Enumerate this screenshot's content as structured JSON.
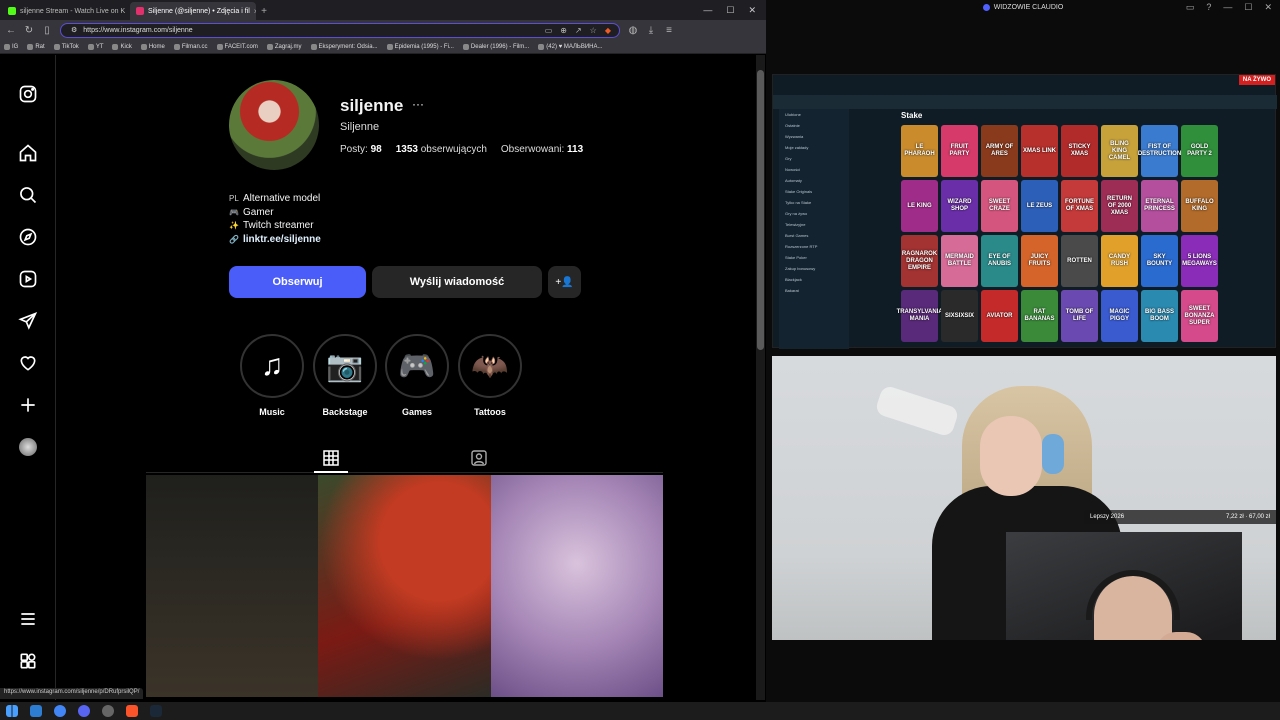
{
  "browser": {
    "tabs": [
      {
        "label": "siljenne Stream - Watch Live on K",
        "color": "#53fc18"
      },
      {
        "label": "Siljenne (@siljenne) • Zdjęcia i fil",
        "color": "#e1306c"
      }
    ],
    "url": "https://www.instagram.com/siljenne",
    "bookmarks": [
      "IG",
      "Rat",
      "TikTok",
      "YT",
      "Kick",
      "Home",
      "Filman.cc",
      "FACEIT.com",
      "Zagraj.my",
      "Eksperyment: Odsia...",
      "Epidemia (1995) - Fi...",
      "Dealer (1996) - Film...",
      "(42) ♥ МАЛЬВИНА..."
    ],
    "status_url": "https://www.instagram.com/siljenne/p/DRufprsilQP/"
  },
  "profile": {
    "username": "siljenne",
    "more": "···",
    "full_name": "Siljenne",
    "posts_label": "Posty:",
    "posts_count": "98",
    "followers": "1353",
    "followers_label": "obserwujących",
    "following_label": "Obserwowani:",
    "following_count": "113",
    "bio": [
      {
        "icon": "PL",
        "text": "Alternative model"
      },
      {
        "icon": "🎮",
        "text": "Gamer"
      },
      {
        "icon": "✨",
        "text": "Twitch streamer"
      }
    ],
    "link": "linktr.ee/siljenne",
    "follow_label": "Obserwuj",
    "message_label": "Wyślij wiadomość",
    "suggest_label": "+ꞌ",
    "highlights": [
      {
        "label": "Music",
        "glyph": "♫"
      },
      {
        "label": "Backstage",
        "glyph": "📷"
      },
      {
        "label": "Games",
        "glyph": "🎮"
      },
      {
        "label": "Tattoos",
        "glyph": "🦇"
      }
    ]
  },
  "obs": {
    "title": "WIDZOWIE CLAUDIO",
    "live_badge": "NA ŻYWO",
    "donation_name": "Lepszy 2026",
    "donation_amount": "7,22 zł · 67,00 zł"
  },
  "stake": {
    "logo": "Stake",
    "sidebar": [
      "Ulubione",
      "Ostatnie",
      "Wyzwania",
      "Moje zakłady",
      "Gry",
      "Nowości",
      "Automaty",
      "Stake Originals",
      "Tylko na Stake",
      "Gry na żywo",
      "Telewizyjne",
      "Burst Games",
      "Rozszerzone RTP",
      "Stake Poker",
      "Zakup bonusowy",
      "Blackjack",
      "Bakarat"
    ],
    "games": [
      {
        "name": "LE PHARAOH",
        "color": "#c98b2c"
      },
      {
        "name": "FRUIT PARTY",
        "color": "#d63a6a"
      },
      {
        "name": "ARMY OF ARES",
        "color": "#8a3a1c"
      },
      {
        "name": "XMAS LINK",
        "color": "#b8302c"
      },
      {
        "name": "STICKY XMAS",
        "color": "#b22b2b"
      },
      {
        "name": "BLING KING CAMEL",
        "color": "#c7a23b"
      },
      {
        "name": "FIST OF DESTRUCTION",
        "color": "#3a7bd0"
      },
      {
        "name": "GOLD PARTY 2",
        "color": "#2f8f3b"
      },
      {
        "name": "LE KING",
        "color": "#a02c8a"
      },
      {
        "name": "WIZARD SHOP",
        "color": "#6a2fa8"
      },
      {
        "name": "SWEET CRAZE",
        "color": "#d4567e"
      },
      {
        "name": "LE ZEUS",
        "color": "#2c5fb8"
      },
      {
        "name": "FORTUNE OF XMAS",
        "color": "#c43a3a"
      },
      {
        "name": "RETURN OF 2000 XMAS",
        "color": "#9e2d56"
      },
      {
        "name": "ETERNAL PRINCESS",
        "color": "#b44f9e"
      },
      {
        "name": "BUFFALO KING",
        "color": "#b26b2a"
      },
      {
        "name": "RAGNAROK DRAGON EMPIRE",
        "color": "#a33232"
      },
      {
        "name": "MERMAID BATTLE",
        "color": "#d66b98"
      },
      {
        "name": "EYE OF ANUBIS",
        "color": "#2a8a8a"
      },
      {
        "name": "JUICY FRUITS",
        "color": "#d4642a"
      },
      {
        "name": "ROTTEN",
        "color": "#4a4a4a"
      },
      {
        "name": "CANDY RUSH",
        "color": "#e0a02a"
      },
      {
        "name": "SKY BOUNTY",
        "color": "#2a6bd0"
      },
      {
        "name": "5 LIONS MEGAWAYS",
        "color": "#8a2cb8"
      },
      {
        "name": "TRANSYLVANIA MANIA",
        "color": "#5a2a7a"
      },
      {
        "name": "SIXSIXSIX",
        "color": "#2a2a2a"
      },
      {
        "name": "AVIATOR",
        "color": "#c42a2a"
      },
      {
        "name": "RAT BANANAS",
        "color": "#3a8a3a"
      },
      {
        "name": "TOMB OF LIFE",
        "color": "#6a4ab0"
      },
      {
        "name": "MAGIC PIGGY",
        "color": "#3a5ad0"
      },
      {
        "name": "BIG BASS BOOM",
        "color": "#2a8ab0"
      },
      {
        "name": "SWEET BONANZA SUPER",
        "color": "#d44a8a"
      }
    ]
  }
}
